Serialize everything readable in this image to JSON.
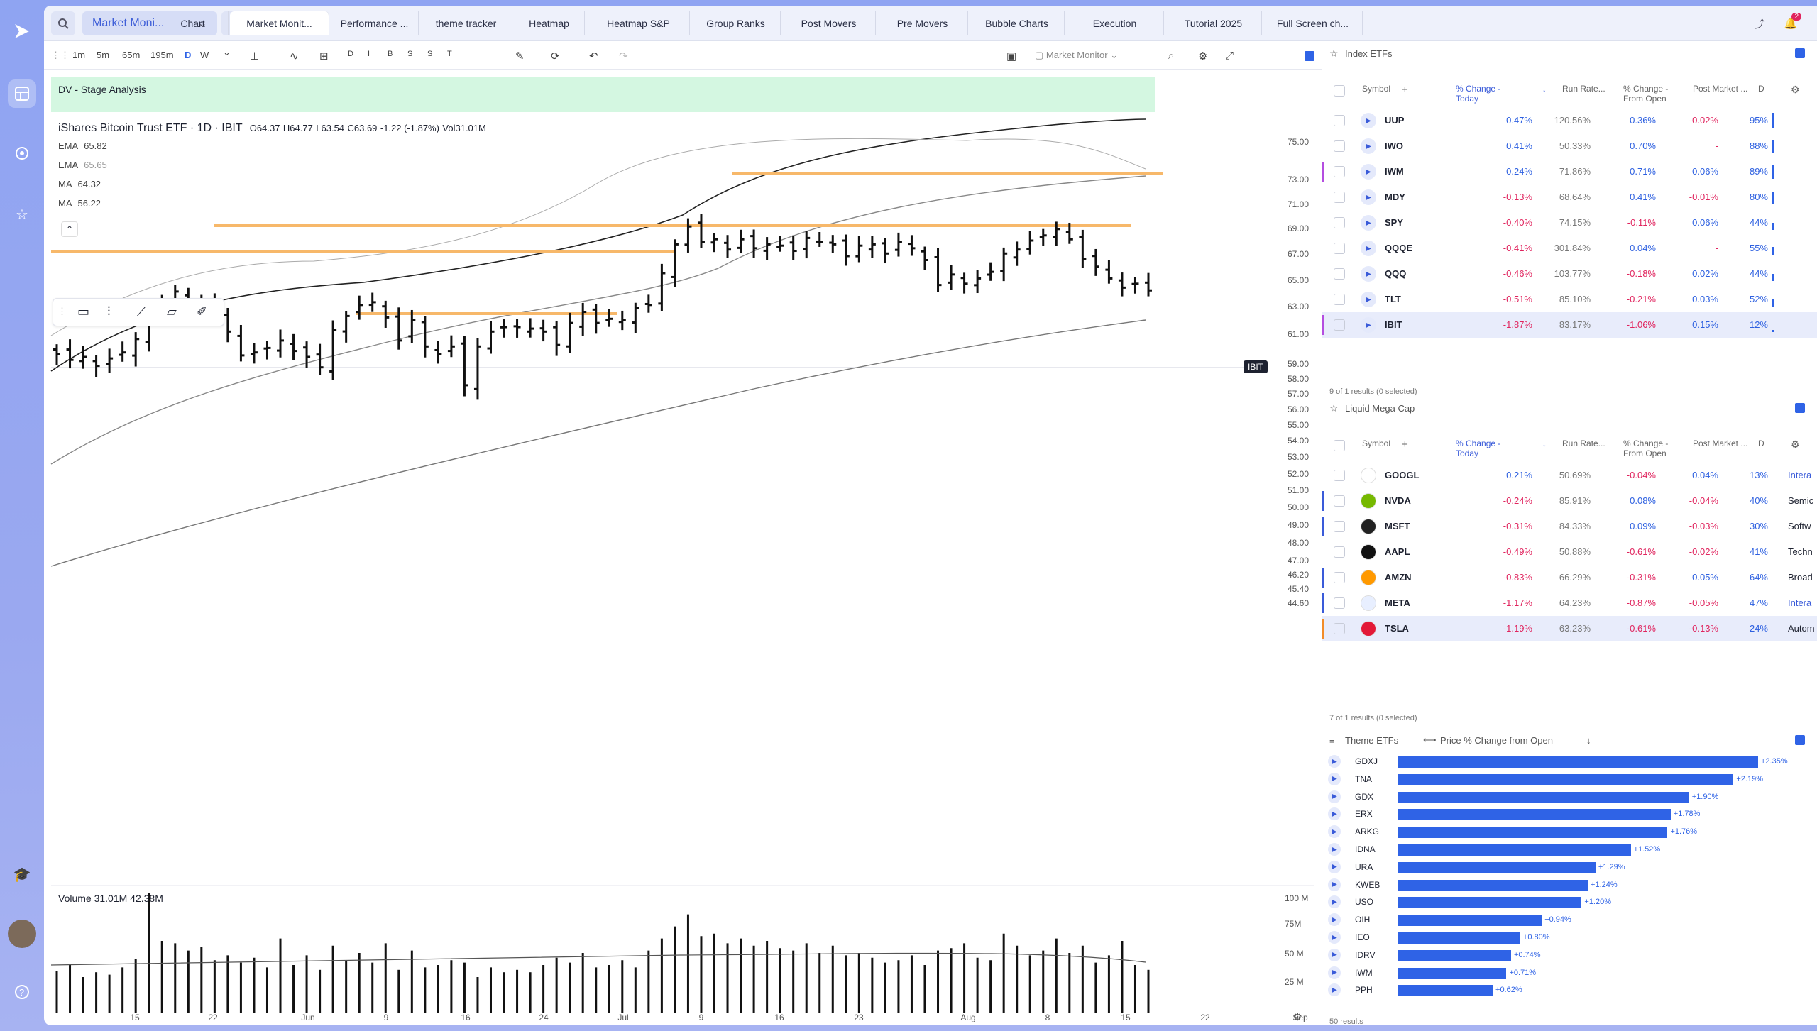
{
  "app": {
    "workspace": "Market Moni...",
    "tabs": [
      "Chart",
      "Market Monit...",
      "Performance ...",
      "theme tracker",
      "Heatmap",
      "Heatmap S&P",
      "Group Ranks",
      "Post Movers",
      "Pre Movers",
      "Bubble Charts",
      "Execution",
      "Tutorial 2025",
      "Full Screen ch..."
    ],
    "active_tab": "Market Monit...",
    "notification_count": "2"
  },
  "toolbar": {
    "timeframes": [
      "1m",
      "5m",
      "65m",
      "195m",
      "D",
      "W"
    ],
    "drawing_tools": [
      "D",
      "I",
      "B",
      "S",
      "S",
      "T"
    ],
    "layout_name": "Market Monitor"
  },
  "chart": {
    "banner": "DV - Stage Analysis",
    "title": "iShares Bitcoin Trust ETF · 1D · IBIT",
    "ohlc": {
      "o": "O64.37",
      "h": "H64.77",
      "l": "L63.54",
      "c": "C63.69",
      "chg": "-1.22 (-1.87%)",
      "vol": "Vol31.01M"
    },
    "indicators": [
      {
        "name": "EMA",
        "value": "65.82"
      },
      {
        "name": "EMA",
        "value": "65.65"
      },
      {
        "name": "MA",
        "value": "64.32"
      },
      {
        "name": "MA",
        "value": "56.22"
      }
    ],
    "price_ticks": [
      "75.00",
      "73.00",
      "71.00",
      "69.00",
      "67.00",
      "65.00",
      "63.00",
      "61.00",
      "59.00",
      "58.00",
      "57.00",
      "56.00",
      "55.00",
      "54.00",
      "53.00",
      "52.00",
      "51.00",
      "50.00",
      "49.00",
      "48.00",
      "47.00",
      "46.20",
      "45.40",
      "44.60"
    ],
    "symbol_tag": "IBIT",
    "volume_label": "Volume",
    "volume_values": "31.01M  42.38M",
    "volume_ticks": [
      "100 M",
      "75M",
      "50 M",
      "25 M"
    ],
    "date_ticks": [
      "15",
      "22",
      "Jun",
      "9",
      "16",
      "24",
      "Jul",
      "9",
      "16",
      "23",
      "Aug",
      "8",
      "15",
      "22",
      "Sep"
    ]
  },
  "chart_data": {
    "type": "ohlc",
    "symbol": "IBIT",
    "bars_close": [
      59.2,
      58.8,
      59.0,
      58.4,
      58.9,
      59.3,
      60.2,
      61.5,
      62.6,
      63.6,
      62.3,
      62.6,
      61.9,
      60.7,
      59.1,
      59.3,
      59.6,
      60.1,
      59.4,
      59.0,
      58.3,
      60.8,
      61.8,
      62.6,
      62.8,
      61.7,
      60.1,
      61.5,
      59.7,
      59.2,
      59.7,
      57.1,
      59.7,
      60.7,
      61.0,
      61.0,
      60.9,
      60.7,
      59.8,
      61.3,
      62.1,
      61.3,
      61.6,
      61.5,
      62.4,
      62.6,
      65.0,
      67.2,
      68.6,
      67.4,
      67.6,
      66.8,
      67.6,
      66.9,
      67.2,
      67.1,
      66.7,
      67.7,
      67.4,
      67.2,
      66.3,
      67.1,
      67.2,
      66.5,
      67.4,
      66.9,
      66.0,
      64.1,
      64.9,
      64.2,
      64.6,
      65.1,
      66.5,
      66.8,
      67.5,
      67.9,
      68.4,
      67.6,
      66.1,
      65.5,
      64.6,
      63.9,
      64.2,
      63.69
    ]
  },
  "panel1": {
    "title": "Index ETFs",
    "cols": [
      "Symbol",
      "% Change - Today",
      "Run Rate...",
      "% Change - From Open",
      "Post Market ...",
      "D"
    ],
    "footer": "9 of 1 results (0 selected)",
    "rows": [
      {
        "sym": "UUP",
        "chg": "0.47%",
        "run": "120.56%",
        "open": "0.36%",
        "post": "-0.02%",
        "d": "95%"
      },
      {
        "sym": "IWO",
        "chg": "0.41%",
        "run": "50.33%",
        "open": "0.70%",
        "post": "-",
        "d": "88%"
      },
      {
        "sym": "IWM",
        "chg": "0.24%",
        "run": "71.86%",
        "open": "0.71%",
        "post": "0.06%",
        "d": "89%"
      },
      {
        "sym": "MDY",
        "chg": "-0.13%",
        "run": "68.64%",
        "open": "0.41%",
        "post": "-0.01%",
        "d": "80%"
      },
      {
        "sym": "SPY",
        "chg": "-0.40%",
        "run": "74.15%",
        "open": "-0.11%",
        "post": "0.06%",
        "d": "44%"
      },
      {
        "sym": "QQQE",
        "chg": "-0.41%",
        "run": "301.84%",
        "open": "0.04%",
        "post": "-",
        "d": "55%"
      },
      {
        "sym": "QQQ",
        "chg": "-0.46%",
        "run": "103.77%",
        "open": "-0.18%",
        "post": "0.02%",
        "d": "44%"
      },
      {
        "sym": "TLT",
        "chg": "-0.51%",
        "run": "85.10%",
        "open": "-0.21%",
        "post": "0.03%",
        "d": "52%"
      },
      {
        "sym": "IBIT",
        "chg": "-1.87%",
        "run": "83.17%",
        "open": "-1.06%",
        "post": "0.15%",
        "d": "12%"
      }
    ]
  },
  "panel2": {
    "title": "Liquid Mega Cap",
    "cols": [
      "Symbol",
      "% Change - Today",
      "Run Rate...",
      "% Change - From Open",
      "Post Market ...",
      "D"
    ],
    "footer": "7 of 1 results (0 selected)",
    "rows": [
      {
        "sym": "GOOGL",
        "chg": "0.21%",
        "run": "50.69%",
        "open": "-0.04%",
        "post": "0.04%",
        "d": "13%",
        "ind": "Intera"
      },
      {
        "sym": "NVDA",
        "chg": "-0.24%",
        "run": "85.91%",
        "open": "0.08%",
        "post": "-0.04%",
        "d": "40%",
        "ind": "Semic"
      },
      {
        "sym": "MSFT",
        "chg": "-0.31%",
        "run": "84.33%",
        "open": "0.09%",
        "post": "-0.03%",
        "d": "30%",
        "ind": "Softw"
      },
      {
        "sym": "AAPL",
        "chg": "-0.49%",
        "run": "50.88%",
        "open": "-0.61%",
        "post": "-0.02%",
        "d": "41%",
        "ind": "Techn"
      },
      {
        "sym": "AMZN",
        "chg": "-0.83%",
        "run": "66.29%",
        "open": "-0.31%",
        "post": "0.05%",
        "d": "64%",
        "ind": "Broad"
      },
      {
        "sym": "META",
        "chg": "-1.17%",
        "run": "64.23%",
        "open": "-0.87%",
        "post": "-0.05%",
        "d": "47%",
        "ind": "Intera"
      },
      {
        "sym": "TSLA",
        "chg": "-1.19%",
        "run": "63.23%",
        "open": "-0.61%",
        "post": "-0.13%",
        "d": "24%",
        "ind": "Autom"
      }
    ]
  },
  "panel3": {
    "title": "Theme ETFs",
    "metric": "Price % Change from Open",
    "footer": "50 results",
    "rows": [
      {
        "sym": "GDXJ",
        "val": 2.35,
        "lbl": "+2.35%"
      },
      {
        "sym": "TNA",
        "val": 2.19,
        "lbl": "+2.19%"
      },
      {
        "sym": "GDX",
        "val": 1.9,
        "lbl": "+1.90%"
      },
      {
        "sym": "ERX",
        "val": 1.78,
        "lbl": "+1.78%"
      },
      {
        "sym": "ARKG",
        "val": 1.76,
        "lbl": "+1.76%"
      },
      {
        "sym": "IDNA",
        "val": 1.52,
        "lbl": "+1.52%"
      },
      {
        "sym": "URA",
        "val": 1.29,
        "lbl": "+1.29%"
      },
      {
        "sym": "KWEB",
        "val": 1.24,
        "lbl": "+1.24%"
      },
      {
        "sym": "USO",
        "val": 1.2,
        "lbl": "+1.20%"
      },
      {
        "sym": "OIH",
        "val": 0.94,
        "lbl": "+0.94%"
      },
      {
        "sym": "IEO",
        "val": 0.8,
        "lbl": "+0.80%"
      },
      {
        "sym": "IDRV",
        "val": 0.74,
        "lbl": "+0.74%"
      },
      {
        "sym": "IWM",
        "val": 0.71,
        "lbl": "+0.71%"
      },
      {
        "sym": "PPH",
        "val": 0.62,
        "lbl": "+0.62%"
      }
    ]
  }
}
